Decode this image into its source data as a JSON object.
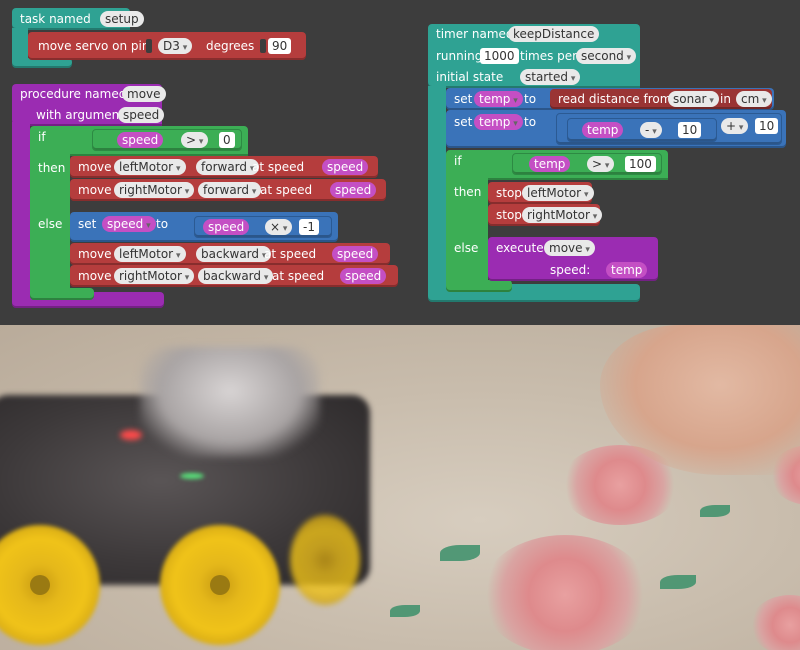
{
  "blocks": {
    "setup": {
      "header": "task named",
      "name": "setup",
      "servo": {
        "label": "move servo on pin",
        "pin": "D3",
        "degrees_label": "degrees",
        "degrees": "90"
      }
    },
    "procedure": {
      "header": "procedure named",
      "name": "move",
      "arg_label": "with argument",
      "arg": "speed",
      "if_label": "if",
      "cond": {
        "var": "speed",
        "op": ">",
        "value": "0"
      },
      "then_label": "then",
      "then_rows": [
        {
          "verb": "move",
          "motor": "leftMotor",
          "dir": "forward",
          "at": "at speed",
          "var": "speed"
        },
        {
          "verb": "move",
          "motor": "rightMotor",
          "dir": "forward",
          "at": "at speed",
          "var": "speed"
        }
      ],
      "else_label": "else",
      "set": {
        "label": "set",
        "var": "speed",
        "to": "to",
        "lhs": "speed",
        "op": "×",
        "value": "-1"
      },
      "else_rows": [
        {
          "verb": "move",
          "motor": "leftMotor",
          "dir": "backward",
          "at": "at speed",
          "var": "speed"
        },
        {
          "verb": "move",
          "motor": "rightMotor",
          "dir": "backward",
          "at": "at speed",
          "var": "speed"
        }
      ]
    },
    "timer": {
      "header": "timer named",
      "name": "keepDistance",
      "running_label": "running",
      "rate": "1000",
      "times_per": "times per",
      "unit": "second",
      "state_label": "initial state",
      "state": "started",
      "set1": {
        "label": "set",
        "var": "temp",
        "to": "to",
        "read": "read distance from",
        "sensor": "sonar",
        "in": "in",
        "unit": "cm"
      },
      "set2": {
        "label": "set",
        "var": "temp",
        "to": "to",
        "inner_var": "temp",
        "op1": "-",
        "val1": "10",
        "op2": "+",
        "val2": "10"
      },
      "if_label": "if",
      "cond": {
        "var": "temp",
        "op": ">",
        "value": "100"
      },
      "then_label": "then",
      "stops": [
        {
          "label": "stop",
          "motor": "leftMotor"
        },
        {
          "label": "stop",
          "motor": "rightMotor"
        }
      ],
      "else_label": "else",
      "exec": {
        "label": "execute",
        "proc": "move",
        "arg_label": "speed:",
        "arg": "temp"
      }
    }
  }
}
